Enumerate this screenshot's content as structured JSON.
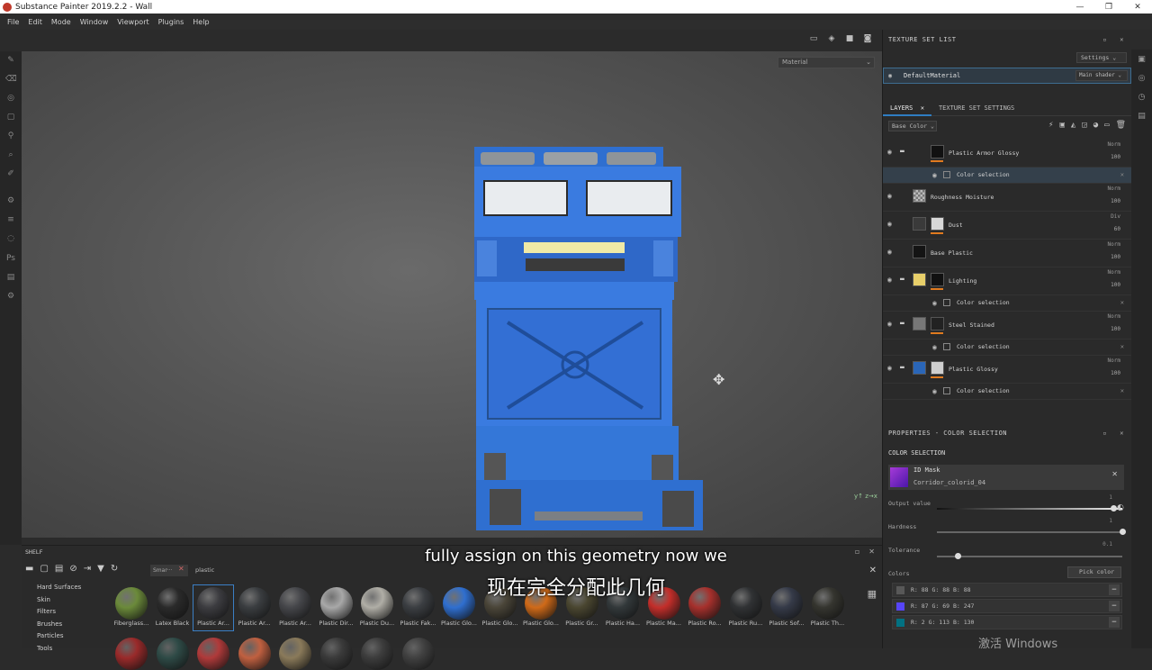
{
  "window": {
    "title": "Substance Painter 2019.2.2 - Wall",
    "controls": [
      "—",
      "❐",
      "✕"
    ]
  },
  "menu": [
    "File",
    "Edit",
    "Mode",
    "Window",
    "Viewport",
    "Plugins",
    "Help"
  ],
  "viewport": {
    "material_select": "Material"
  },
  "texture_set_list": {
    "title": "TEXTURE SET LIST",
    "settings_label": "Settings",
    "row_name": "DefaultMaterial",
    "shader": "Main shader"
  },
  "layers_panel": {
    "tabs": [
      "LAYERS",
      "TEXTURE SET SETTINGS"
    ],
    "channel": "Base Color",
    "layers": [
      {
        "name": "Plastic Armor Glossy",
        "blend": "Norm",
        "opacity": "100",
        "folder": true,
        "thumb": "#111111"
      },
      {
        "name": "Color selection",
        "sub": true,
        "selected": true
      },
      {
        "name": "Roughness Moisture",
        "blend": "Norm",
        "opacity": "100",
        "folder": false,
        "thumb": "#9a9a9a"
      },
      {
        "name": "Dust",
        "blend": "Div",
        "opacity": "60",
        "folder": false,
        "thumb": "#d8d8d8"
      },
      {
        "name": "Base Plastic",
        "blend": "Norm",
        "opacity": "100",
        "folder": false,
        "thumb": "#141414"
      },
      {
        "name": "Lighting",
        "blend": "Norm",
        "opacity": "100",
        "folder": true,
        "thumb": "#e8cf6a"
      },
      {
        "name": "Color selection",
        "sub": true
      },
      {
        "name": "Steel Stained",
        "blend": "Norm",
        "opacity": "100",
        "folder": true,
        "thumb": "#777777"
      },
      {
        "name": "Color selection",
        "sub": true
      },
      {
        "name": "Plastic Glossy",
        "blend": "Norm",
        "opacity": "100",
        "folder": true,
        "thumb": "#2a66b8"
      },
      {
        "name": "Color selection",
        "sub": true
      }
    ]
  },
  "properties": {
    "title": "PROPERTIES - COLOR SELECTION",
    "section": "COLOR SELECTION",
    "mask_name": "ID Mask",
    "mask_sub": "Corridor_colorid_04",
    "output_value_label": "Output value",
    "output_value_max": "1",
    "hardness_label": "Hardness",
    "hardness_max": "1",
    "tolerance_label": "Tolerance",
    "tolerance_max": "0.1",
    "colors_label": "Colors",
    "pick_color": "Pick color",
    "colors": [
      {
        "swatch": "#585858",
        "text": "R: 88   G: 88   B: 88"
      },
      {
        "swatch": "#5745f7",
        "text": "R: 87   G: 69   B: 247"
      },
      {
        "swatch": "#027182",
        "text": "R: 2    G: 113   B: 130"
      }
    ]
  },
  "shelf": {
    "title": "SHELF",
    "search_chip": "Smar···",
    "search_text": "plastic",
    "categories": [
      "Hard Surfaces",
      "Skin",
      "Filters",
      "Brushes",
      "Particles",
      "Tools"
    ],
    "materials": [
      {
        "label": "Fiberglass...",
        "color": "#6b8a3a"
      },
      {
        "label": "Latex Black",
        "color": "#2a2a2a"
      },
      {
        "label": "Plastic Ar...",
        "color": "#3c3c40",
        "selected": true
      },
      {
        "label": "Plastic Ar...",
        "color": "#3a3d40"
      },
      {
        "label": "Plastic Ar...",
        "color": "#45464a"
      },
      {
        "label": "Plastic Dir...",
        "color": "#a8a8a8"
      },
      {
        "label": "Plastic Du...",
        "color": "#b0aea6"
      },
      {
        "label": "Plastic Fak...",
        "color": "#3b3e42"
      },
      {
        "label": "Plastic Glo...",
        "color": "#2f6fd0"
      },
      {
        "label": "Plastic Glo...",
        "color": "#4a4538"
      },
      {
        "label": "Plastic Glo...",
        "color": "#d06a18"
      },
      {
        "label": "Plastic Gr...",
        "color": "#4a4630"
      },
      {
        "label": "Plastic Ha...",
        "color": "#32383a"
      },
      {
        "label": "Plastic Ma...",
        "color": "#c32e2a"
      },
      {
        "label": "Plastic Ro...",
        "color": "#a6302c"
      },
      {
        "label": "Plastic Ru...",
        "color": "#303234"
      },
      {
        "label": "Plastic Sof...",
        "color": "#353a48"
      },
      {
        "label": "Plastic Th...",
        "color": "#35352f"
      }
    ],
    "row2_colors": [
      "#9a2a2a",
      "#2e4a46",
      "#b03a3a",
      "#c06040",
      "#8a7a5a",
      "#3a3a3a",
      "#3c3c3c",
      "#404040"
    ]
  },
  "subtitles": {
    "en": "fully assign on this geometry now we",
    "cn": "现在完全分配此几何"
  },
  "watermark": "激活 Windows"
}
